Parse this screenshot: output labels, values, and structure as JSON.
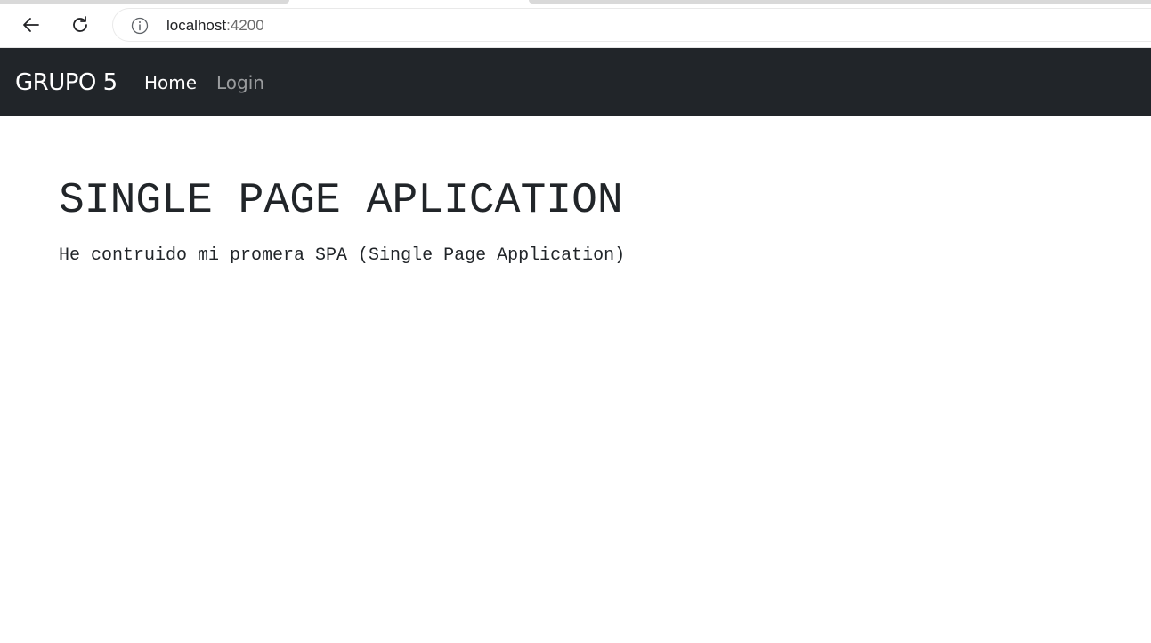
{
  "browser": {
    "url_host": "localhost",
    "url_port": ":4200",
    "icons": {
      "back": "arrow-left-icon",
      "reload": "reload-icon",
      "site_info": "info-icon"
    }
  },
  "navbar": {
    "brand": "GRUPO 5",
    "links": [
      {
        "label": "Home",
        "active": true
      },
      {
        "label": "Login",
        "active": false
      }
    ],
    "background": "#212529"
  },
  "main": {
    "title": "SINGLE PAGE APLICATION",
    "text": "He contruido mi promera SPA (Single Page Application)"
  }
}
